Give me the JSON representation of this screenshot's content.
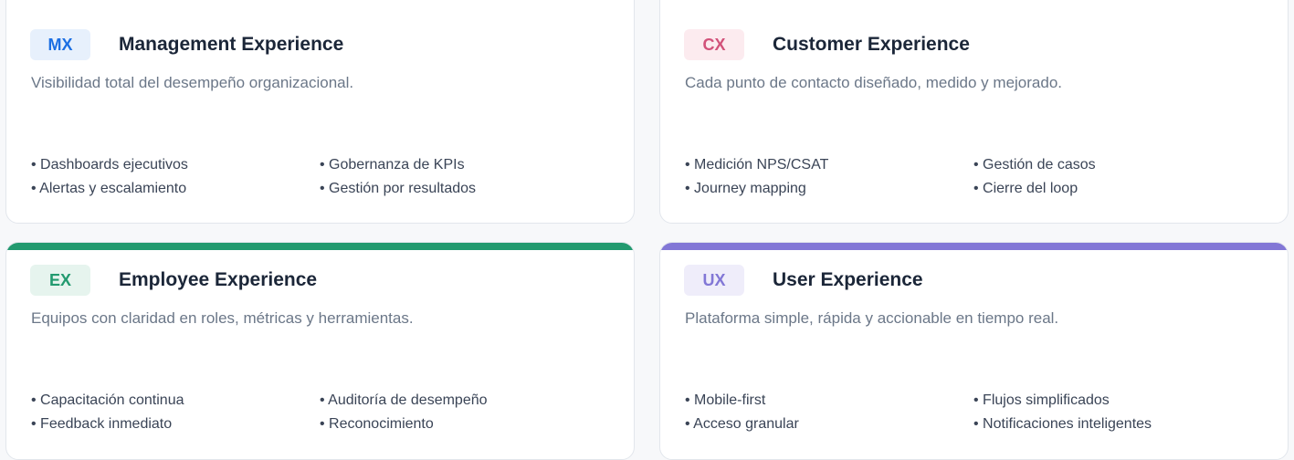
{
  "cards": {
    "mx": {
      "badge": "MX",
      "title": "Management Experience",
      "description": "Visibilidad total del desempeño organizacional.",
      "accent": "#1c6fe3",
      "badge_bg": "#e7f0fc",
      "features": [
        "Dashboards ejecutivos",
        "Gobernanza de KPIs",
        "Alertas y escalamiento",
        "Gestión por resultados"
      ]
    },
    "cx": {
      "badge": "CX",
      "title": "Customer Experience",
      "description": "Cada punto de contacto diseñado, medido y mejorado.",
      "accent": "#d2527a",
      "badge_bg": "#fcebef",
      "features": [
        "Medición NPS/CSAT",
        "Gestión de casos",
        "Journey mapping",
        "Cierre del loop"
      ]
    },
    "ex": {
      "badge": "EX",
      "title": "Employee Experience",
      "description": "Equipos con claridad en roles, métricas y herramientas.",
      "accent": "#229a6f",
      "badge_bg": "#e6f4ee",
      "features": [
        "Capacitación continua",
        "Auditoría de desempeño",
        "Feedback inmediato",
        "Reconocimiento"
      ]
    },
    "ux": {
      "badge": "UX",
      "title": "User Experience",
      "description": "Plataforma simple, rápida y accionable en tiempo real.",
      "accent": "#8277d6",
      "badge_bg": "#efedfa",
      "features": [
        "Mobile-first",
        "Flujos simplificados",
        "Acceso granular",
        "Notificaciones inteligentes"
      ]
    }
  }
}
